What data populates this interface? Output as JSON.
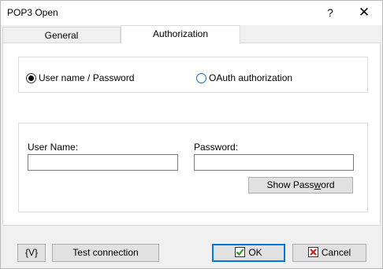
{
  "window": {
    "title": "POP3 Open",
    "help_label": "?",
    "close_label": "✕"
  },
  "tabs": [
    {
      "label": "General",
      "active": false
    },
    {
      "label": "Authorization",
      "active": true
    }
  ],
  "auth_mode": {
    "options": [
      {
        "label": "User name / Password",
        "selected": true
      },
      {
        "label": "OAuth authorization",
        "selected": false
      }
    ]
  },
  "credentials": {
    "username_label": "User Name:",
    "username_value": "",
    "password_label": "Password:",
    "password_value": "",
    "show_password": {
      "before": "Show Pass",
      "mnemonic": "w",
      "after": "ord"
    }
  },
  "footer": {
    "variables_label": "{V}",
    "test_connection_label": "Test connection",
    "ok_label": "OK",
    "cancel_label": "Cancel"
  },
  "colors": {
    "ok_check": "#2a9d2a",
    "cancel_x": "#d42020",
    "focus_border": "#0078d7",
    "radio_blue": "#1b6ac9"
  },
  "icons": {
    "ok": "green-check-icon",
    "cancel": "red-x-icon"
  }
}
